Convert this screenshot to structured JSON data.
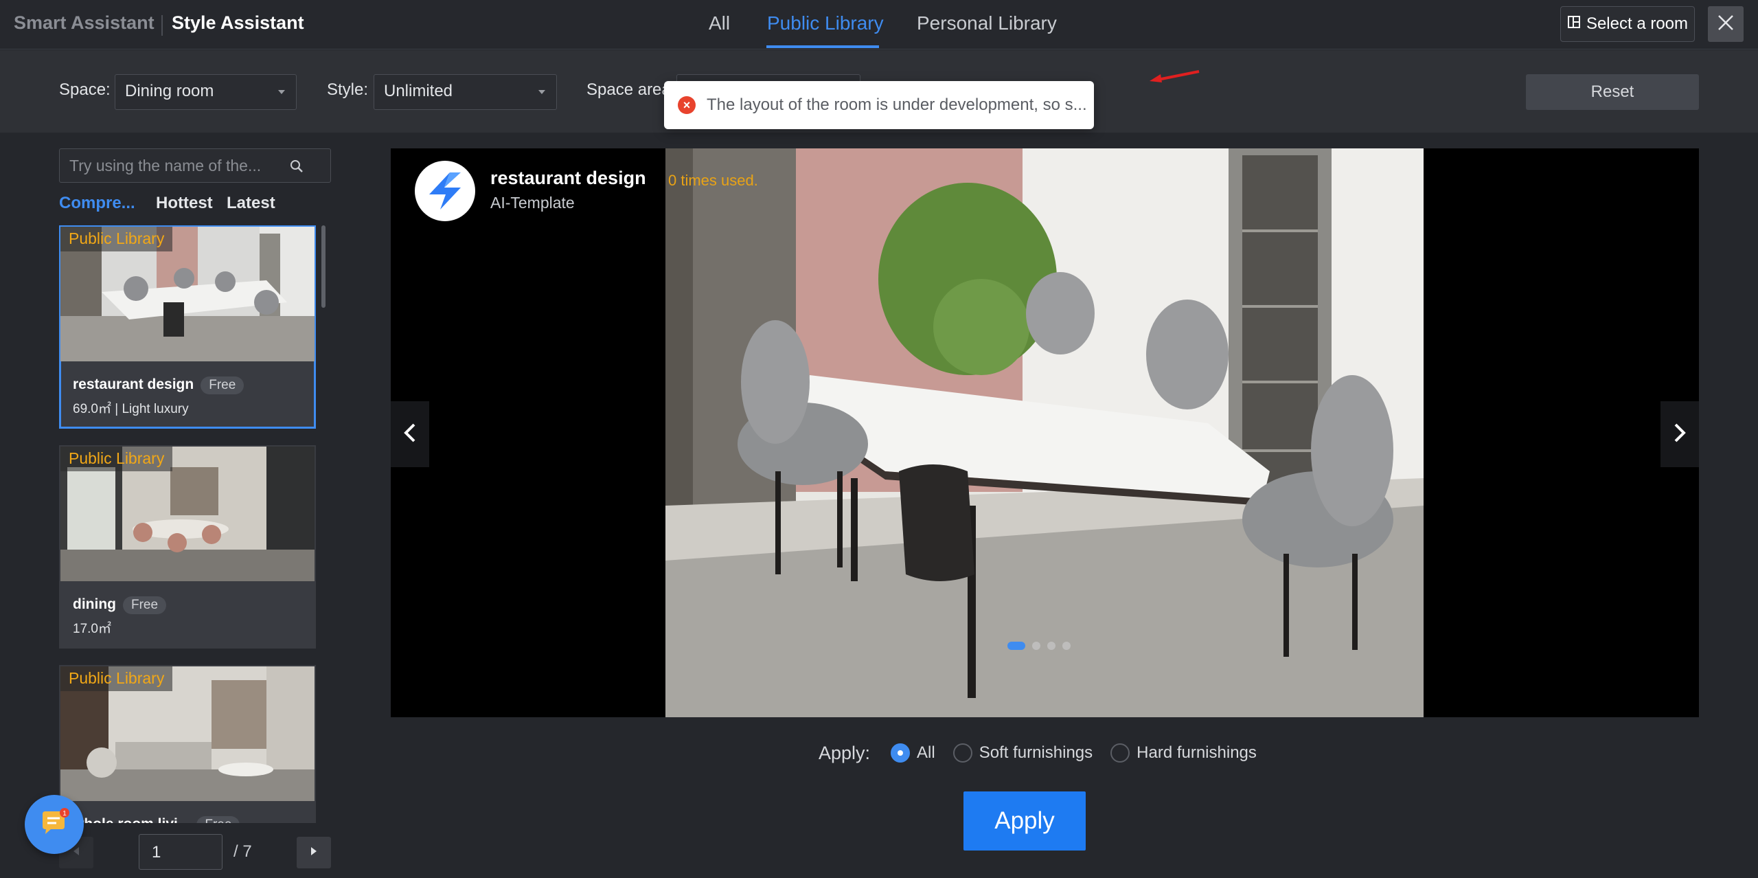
{
  "header": {
    "brand": "Smart Assistant",
    "current_tool": "Style Assistant",
    "tabs": [
      {
        "label": "All",
        "active": false
      },
      {
        "label": "Public Library",
        "active": true
      },
      {
        "label": "Personal Library",
        "active": false
      }
    ],
    "select_room_label": "Select a room"
  },
  "filters": {
    "space_label": "Space:",
    "space_value": "Dining room",
    "style_label": "Style:",
    "style_value": "Unlimited",
    "area_label": "Space area",
    "reset_label": "Reset"
  },
  "toast": {
    "type": "error",
    "message": "The layout of the room is under development, so s..."
  },
  "sidebar": {
    "search_placeholder": "Try using the name of the...",
    "sort_tabs": [
      {
        "label": "Compre...",
        "active": true
      },
      {
        "label": "Hottest",
        "active": false
      },
      {
        "label": "Latest",
        "active": false
      }
    ],
    "cards": [
      {
        "badge": "Public Library",
        "name": "restaurant design",
        "price": "Free",
        "meta": "69.0㎡ | Light luxury",
        "selected": true
      },
      {
        "badge": "Public Library",
        "name": "dining",
        "price": "Free",
        "meta": "17.0㎡",
        "selected": false
      },
      {
        "badge": "Public Library",
        "name": "whole room livi...",
        "price": "Free",
        "meta": "",
        "selected": false
      }
    ],
    "pagination": {
      "current": "1",
      "total": "/ 7"
    },
    "chat_badge_count": "1"
  },
  "preview": {
    "title": "restaurant design",
    "subtitle": "AI-Template",
    "usage": "0 times used.",
    "slide_count": 4,
    "active_slide": 0
  },
  "apply": {
    "label": "Apply:",
    "options": [
      {
        "label": "All",
        "checked": true
      },
      {
        "label": "Soft furnishings",
        "checked": false
      },
      {
        "label": "Hard furnishings",
        "checked": false
      }
    ],
    "button_label": "Apply"
  },
  "colors": {
    "accent": "#3f8cf0",
    "badge": "#f2a817",
    "usage": "#e9a315",
    "error": "#e8432d"
  }
}
